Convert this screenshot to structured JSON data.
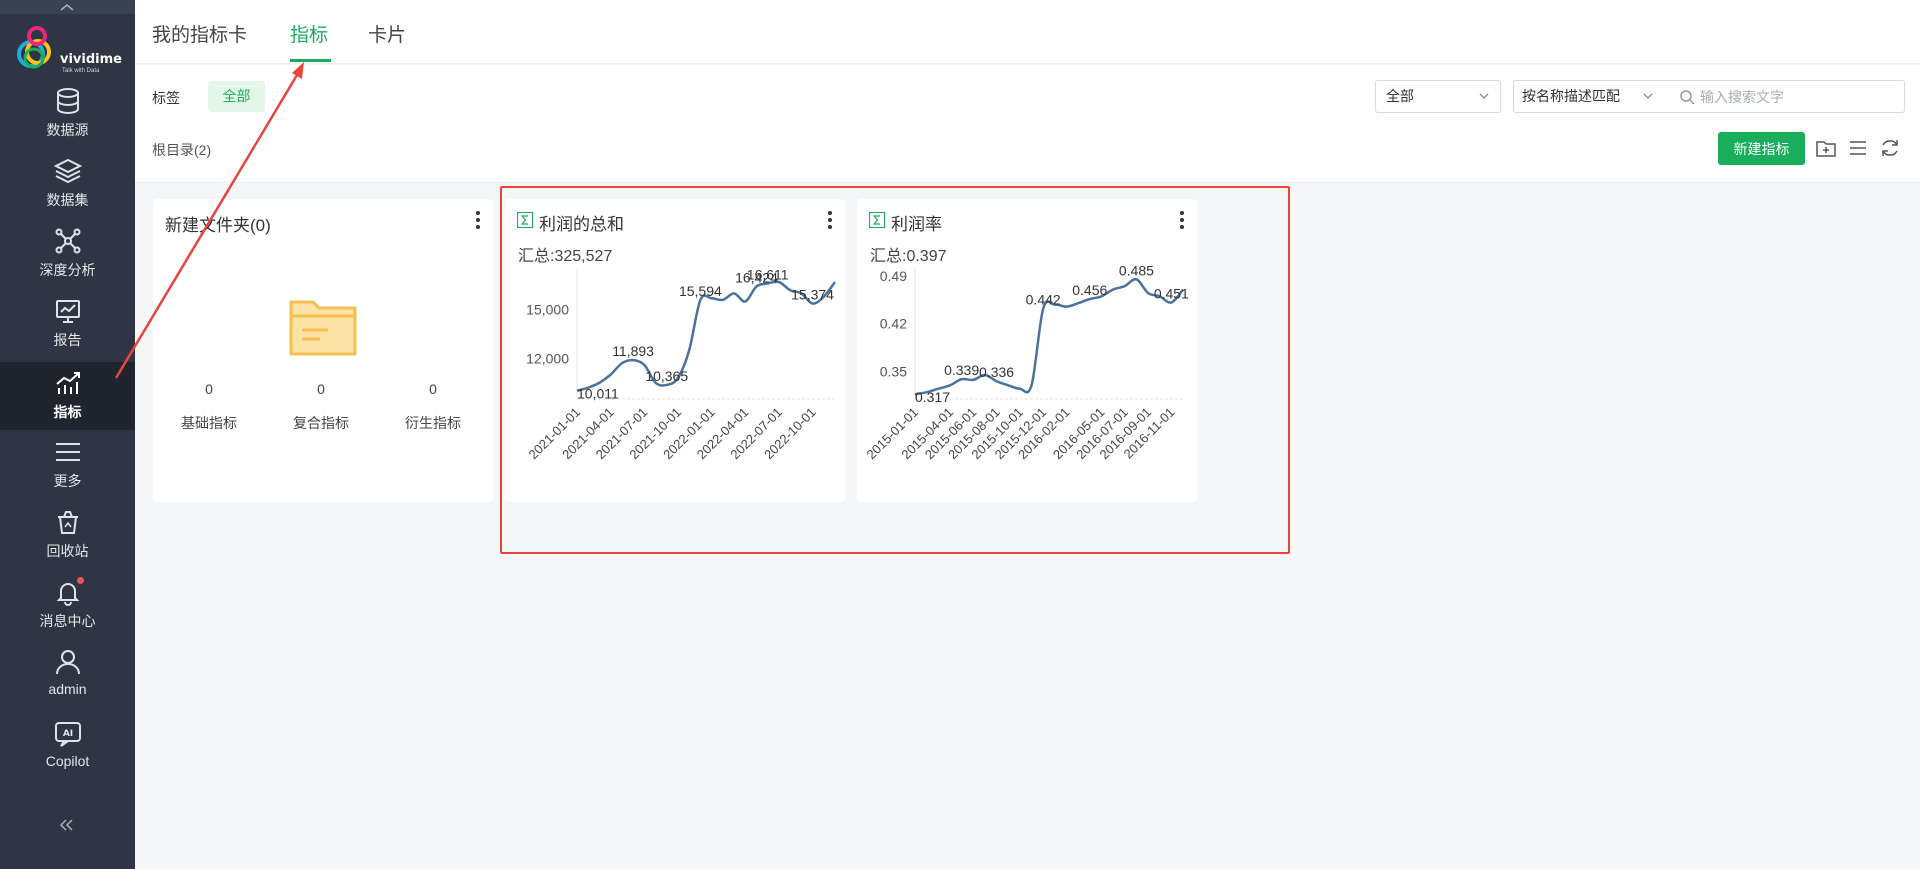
{
  "sidebar": {
    "logo_text": "vividime",
    "logo_sub": "Talk with Data",
    "items": [
      {
        "label": "数据源",
        "icon": "database-icon"
      },
      {
        "label": "数据集",
        "icon": "layers-icon"
      },
      {
        "label": "深度分析",
        "icon": "network-icon"
      },
      {
        "label": "报告",
        "icon": "report-icon"
      },
      {
        "label": "指标",
        "icon": "metric-chart-icon",
        "active": true
      },
      {
        "label": "更多",
        "icon": "menu-icon"
      },
      {
        "label": "回收站",
        "icon": "recycle-bin-icon"
      },
      {
        "label": "消息中心",
        "icon": "bell-icon"
      },
      {
        "label": "admin",
        "icon": "user-icon"
      },
      {
        "label": "Copilot",
        "icon": "ai-icon"
      }
    ]
  },
  "tabs": [
    {
      "label": "我的指标卡"
    },
    {
      "label": "指标",
      "active": true
    },
    {
      "label": "卡片"
    }
  ],
  "toolbar": {
    "tag_label": "标签",
    "tag_all": "全部",
    "root_dir": "根目录(2)",
    "type_select": "全部",
    "match_select": "按名称描述匹配",
    "search_placeholder": "输入搜索文字",
    "new_button": "新建指标"
  },
  "folder_card": {
    "title": "新建文件夹(0)",
    "stats": [
      {
        "value": "0",
        "name": "基础指标"
      },
      {
        "value": "0",
        "name": "复合指标"
      },
      {
        "value": "0",
        "name": "衍生指标"
      }
    ]
  },
  "metric_cards": [
    {
      "title": "利润的总和",
      "summary": "汇总:325,527"
    },
    {
      "title": "利润率",
      "summary": "汇总:0.397"
    }
  ],
  "colors": {
    "accent": "#1aad5b",
    "sidebar": "#2f3542",
    "line": "#4a72a0",
    "highlight": "#e8453c"
  },
  "chart_data": [
    {
      "type": "line",
      "x": [
        "2021-01-01",
        "2021-02-01",
        "2021-03-01",
        "2021-04-01",
        "2021-05-01",
        "2021-06-01",
        "2021-07-01",
        "2021-08-01",
        "2021-09-01",
        "2021-10-01",
        "2021-11-01",
        "2021-12-01",
        "2022-01-01",
        "2022-02-01",
        "2022-03-01",
        "2022-04-01",
        "2022-05-01",
        "2022-06-01",
        "2022-07-01",
        "2022-08-01",
        "2022-09-01",
        "2022-10-01",
        "2022-11-01",
        "2022-12-01"
      ],
      "values": [
        10011,
        10200,
        10500,
        11000,
        11700,
        11893,
        11600,
        10500,
        10365,
        10800,
        12500,
        15594,
        15700,
        15600,
        16000,
        15500,
        16424,
        16611,
        16700,
        16200,
        16000,
        15374,
        15800,
        16700
      ],
      "x_ticks": [
        "2021-01-01",
        "2021-04-01",
        "2021-07-01",
        "2021-10-01",
        "2022-01-01",
        "2022-04-01",
        "2022-07-01",
        "2022-10-01"
      ],
      "y_ticks": [
        "12,000",
        "15,000"
      ],
      "data_labels": [
        {
          "i": 0,
          "text": "10,011"
        },
        {
          "i": 5,
          "text": "11,893"
        },
        {
          "i": 8,
          "text": "10,365"
        },
        {
          "i": 11,
          "text": "15,594"
        },
        {
          "i": 16,
          "text": "16,424"
        },
        {
          "i": 17,
          "text": "16,611"
        },
        {
          "i": 21,
          "text": "15,374"
        }
      ],
      "ylim": [
        9500,
        17500
      ]
    },
    {
      "type": "line",
      "x": [
        "2015-01-01",
        "2015-02-01",
        "2015-03-01",
        "2015-04-01",
        "2015-05-01",
        "2015-06-01",
        "2015-07-01",
        "2015-08-01",
        "2015-09-01",
        "2015-10-01",
        "2015-11-01",
        "2015-12-01",
        "2016-01-01",
        "2016-02-01",
        "2016-03-01",
        "2016-04-01",
        "2016-05-01",
        "2016-06-01",
        "2016-07-01",
        "2016-08-01",
        "2016-09-01",
        "2016-10-01",
        "2016-11-01",
        "2016-12-01"
      ],
      "values": [
        0.317,
        0.32,
        0.325,
        0.33,
        0.339,
        0.338,
        0.345,
        0.336,
        0.33,
        0.325,
        0.33,
        0.442,
        0.448,
        0.445,
        0.45,
        0.456,
        0.46,
        0.47,
        0.475,
        0.485,
        0.465,
        0.46,
        0.451,
        0.47
      ],
      "x_ticks": [
        "2015-01-01",
        "2015-04-01",
        "2015-06-01",
        "2015-08-01",
        "2015-10-01",
        "2015-12-01",
        "2016-02-01",
        "2016-05-01",
        "2016-07-01",
        "2016-09-01",
        "2016-11-01"
      ],
      "y_ticks": [
        "0.35",
        "0.42",
        "0.49"
      ],
      "data_labels": [
        {
          "i": 0,
          "text": "0.317"
        },
        {
          "i": 4,
          "text": "0.339"
        },
        {
          "i": 7,
          "text": "0.336"
        },
        {
          "i": 11,
          "text": "0.442"
        },
        {
          "i": 15,
          "text": "0.456"
        },
        {
          "i": 19,
          "text": "0.485"
        },
        {
          "i": 22,
          "text": "0.451"
        }
      ],
      "ylim": [
        0.31,
        0.5
      ]
    }
  ]
}
